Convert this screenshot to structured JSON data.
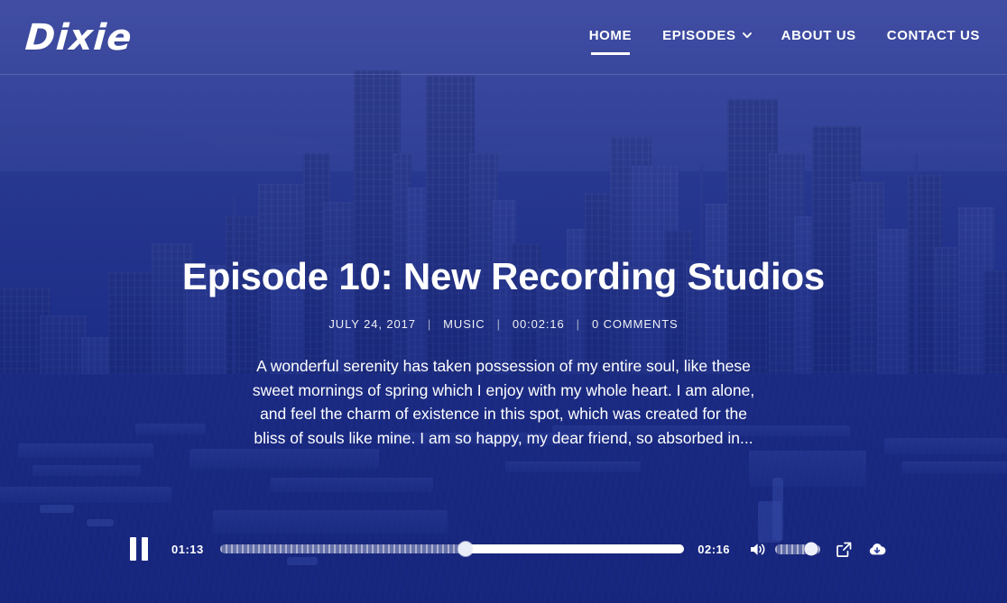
{
  "site": {
    "logo_text": "Dixie"
  },
  "nav": {
    "items": [
      {
        "label": "HOME",
        "icon": "",
        "active": true
      },
      {
        "label": "EPISODES",
        "icon": "chevron-down-icon",
        "active": false
      },
      {
        "label": "ABOUT US",
        "icon": "",
        "active": false
      },
      {
        "label": "CONTACT US",
        "icon": "",
        "active": false
      }
    ]
  },
  "episode": {
    "title": "Episode 10: New Recording Studios",
    "meta": {
      "date": "JULY 24, 2017",
      "category": "MUSIC",
      "duration": "00:02:16",
      "comments": "0 COMMENTS",
      "separator": "|"
    },
    "description": "A wonderful serenity has taken possession of my entire soul, like these sweet mornings of spring which I enjoy with my whole heart. I am alone, and feel the charm of existence in this spot, which was created for the bliss of souls like mine. I am so happy, my dear friend, so absorbed in..."
  },
  "player": {
    "state": "playing",
    "play_pause_icon": "pause-icon",
    "current_time": "01:13",
    "total_time": "02:16",
    "progress_percent": 53,
    "volume_icon": "speaker-icon",
    "volume_percent": 80,
    "share_icon": "external-link-icon",
    "download_icon": "cloud-download-icon"
  },
  "colors": {
    "overlay_blue": "#3046a4",
    "accent_white": "#ffffff",
    "sky_blue": "#6c7bc2",
    "water_blue": "#2f449b"
  }
}
